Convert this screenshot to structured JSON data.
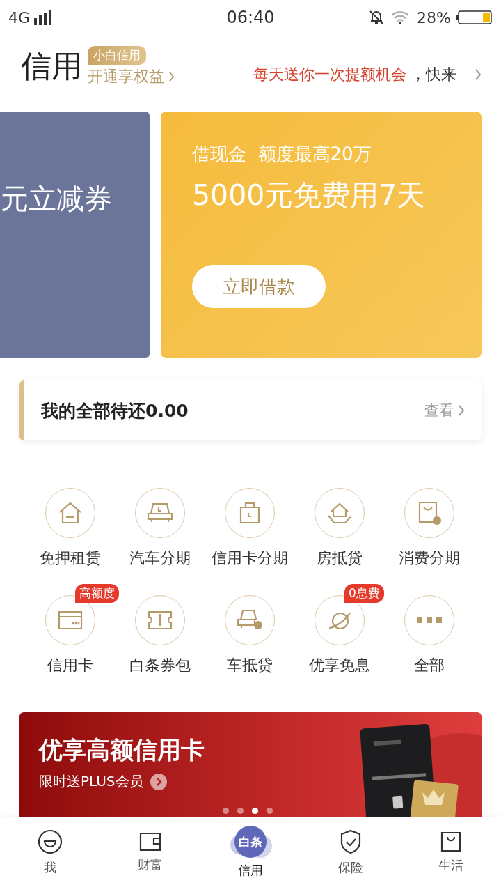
{
  "status_bar": {
    "network": "4G",
    "time": "06:40",
    "battery": "28%"
  },
  "header": {
    "title": "信用",
    "badge": "小白信用",
    "link": "开通享权益",
    "promo": "每天送你一次提额机会",
    "promo_tail": "，快来"
  },
  "carousel": [
    {
      "text": "元立减券"
    },
    {
      "subtitle": "借现金  额度最高20万",
      "title": "5000元免费用7天",
      "button": "立即借款"
    }
  ],
  "repay": {
    "label": "我的全部待还0.00",
    "link": "查看"
  },
  "services": [
    {
      "label": "免押租赁"
    },
    {
      "label": "汽车分期"
    },
    {
      "label": "信用卡分期"
    },
    {
      "label": "房抵贷"
    },
    {
      "label": "消费分期"
    },
    {
      "label": "信用卡",
      "badge": "高额度"
    },
    {
      "label": "白条券包"
    },
    {
      "label": "车抵贷"
    },
    {
      "label": "优享免息",
      "badge": "0息费"
    },
    {
      "label": "全部"
    }
  ],
  "banner": {
    "title": "优享高额信用卡",
    "subtitle": "限时送PLUS会员",
    "dots": [
      {
        "selected": false
      },
      {
        "selected": false
      },
      {
        "selected": true
      },
      {
        "selected": false
      }
    ]
  },
  "tab_bar": [
    {
      "label": "我",
      "selected": false
    },
    {
      "label": "财富",
      "selected": false
    },
    {
      "label": "信用",
      "selected": true,
      "logo_text": "白条"
    },
    {
      "label": "保险",
      "selected": false
    },
    {
      "label": "生活",
      "selected": false
    }
  ]
}
